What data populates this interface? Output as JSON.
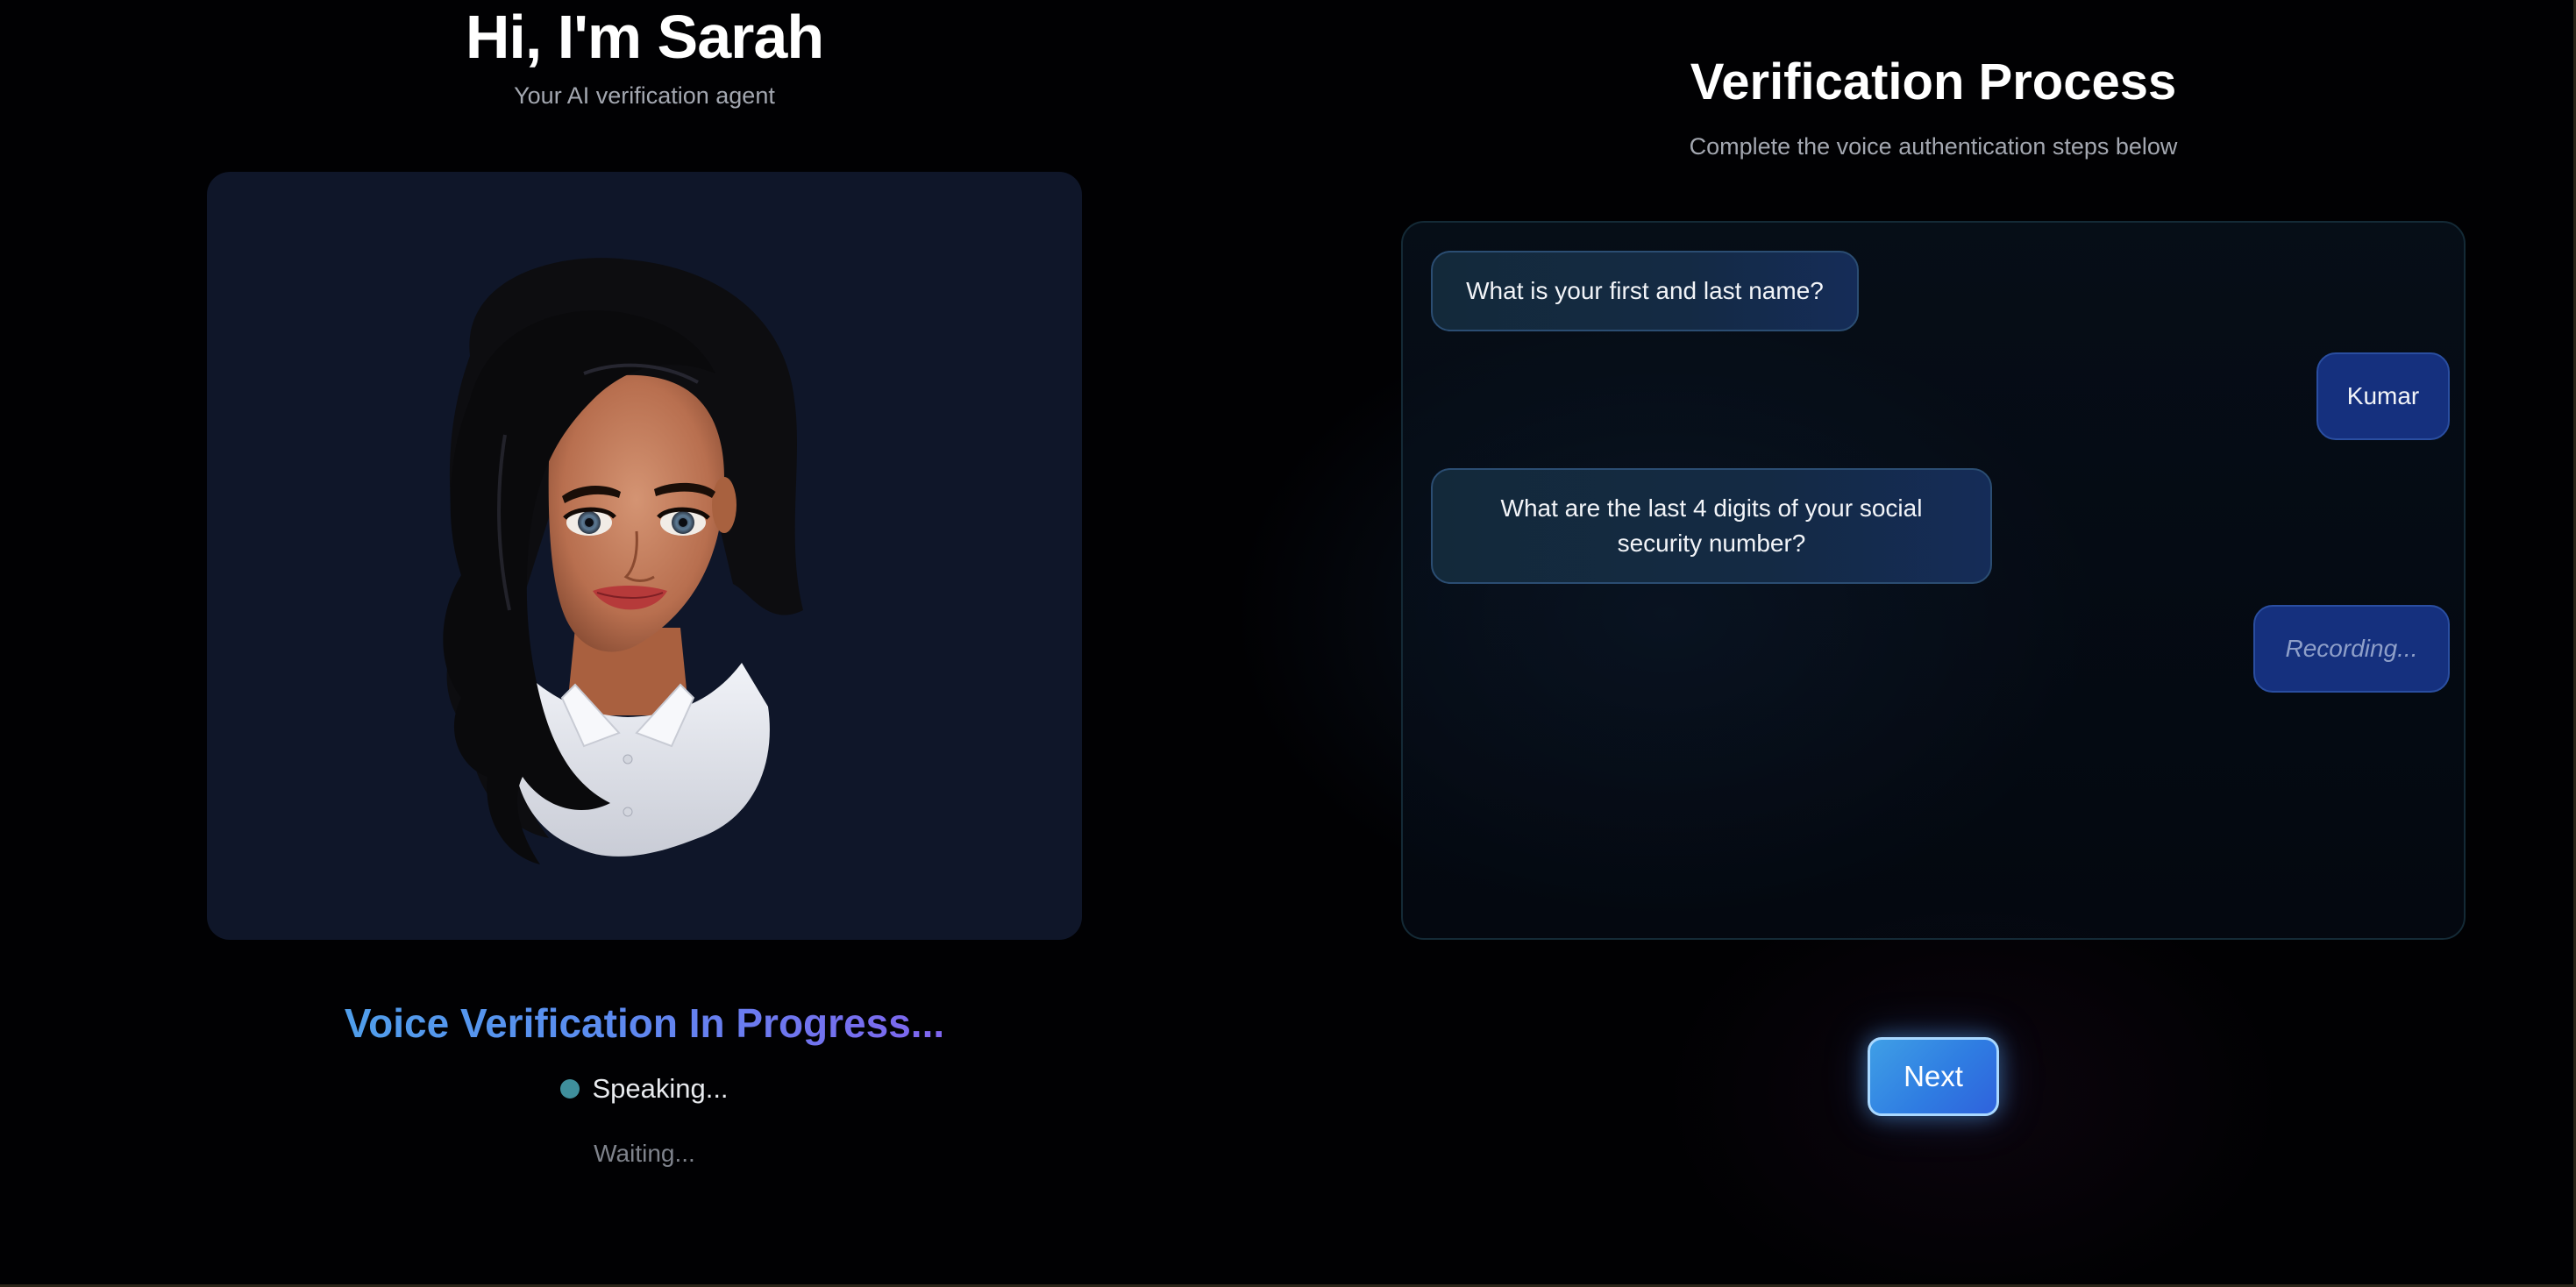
{
  "agent": {
    "title": "Hi, I'm Sarah",
    "subtitle": "Your AI verification agent"
  },
  "status": {
    "heading": "Voice Verification In Progress...",
    "speaking": "Speaking...",
    "waiting": "Waiting..."
  },
  "process": {
    "title": "Verification Process",
    "subtitle": "Complete the voice authentication steps below"
  },
  "chat": {
    "messages": [
      {
        "role": "agent",
        "text": "What is your first and last name?"
      },
      {
        "role": "user",
        "text": "Kumar"
      },
      {
        "role": "agent",
        "text": "What are the last 4 digits of your social security number?"
      },
      {
        "role": "user",
        "text": "Recording..."
      }
    ]
  },
  "actions": {
    "next_label": "Next"
  },
  "colors": {
    "background": "#010103",
    "avatar_panel": "#0f1629",
    "user_bubble": "#15307e",
    "accent_blue": "#3f9fe6",
    "accent_purple": "#8e55ee",
    "speaking_dot": "#3f8f9c"
  },
  "icons": {
    "avatar": "3d-avatar-sarah",
    "status_indicator": "speaking-dot"
  }
}
